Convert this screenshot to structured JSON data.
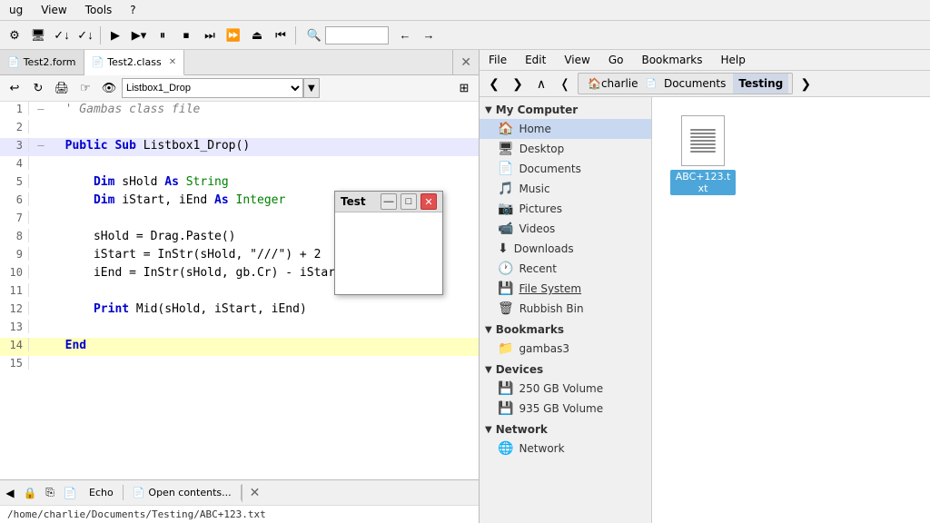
{
  "app_menu": {
    "items": [
      "ug",
      "View",
      "Tools",
      "?"
    ]
  },
  "toolbar": {
    "buttons": [
      "gear",
      "screen",
      "check-down",
      "check-down-2",
      "play",
      "play-drop",
      "pause",
      "stop",
      "step-over",
      "fast-forward",
      "eject",
      "step-into"
    ],
    "search_placeholder": ""
  },
  "nav": {
    "back": "‹",
    "forward": "›"
  },
  "editor": {
    "tabs": [
      {
        "label": "Test2.form",
        "icon": "📄",
        "active": false
      },
      {
        "label": "Test2.class",
        "icon": "📄",
        "active": true
      }
    ],
    "current_function": "Listbox1_Drop",
    "lines": [
      {
        "num": "1",
        "marker": "—",
        "content": "' Gambas class file",
        "type": "comment"
      },
      {
        "num": "2",
        "marker": "",
        "content": "",
        "type": "blank"
      },
      {
        "num": "3",
        "marker": "—",
        "content": "Public Sub Listbox1_Drop()",
        "type": "code"
      },
      {
        "num": "4",
        "marker": "",
        "content": "",
        "type": "blank"
      },
      {
        "num": "5",
        "marker": "",
        "content": "    Dim sHold As String",
        "type": "code"
      },
      {
        "num": "6",
        "marker": "",
        "content": "    Dim iStart, iEnd As Integer",
        "type": "code"
      },
      {
        "num": "7",
        "marker": "",
        "content": "",
        "type": "blank"
      },
      {
        "num": "8",
        "marker": "",
        "content": "    sHold = Drag.Paste()",
        "type": "code"
      },
      {
        "num": "9",
        "marker": "",
        "content": "    iStart = InStr(sHold, \"///\") + 2",
        "type": "code"
      },
      {
        "num": "10",
        "marker": "",
        "content": "    iEnd = InStr(sHold, gb.Cr) - iStart",
        "type": "code"
      },
      {
        "num": "11",
        "marker": "",
        "content": "",
        "type": "blank"
      },
      {
        "num": "12",
        "marker": "",
        "content": "    Print Mid(sHold, iStart, iEnd)",
        "type": "code"
      },
      {
        "num": "13",
        "marker": "",
        "content": "",
        "type": "blank"
      },
      {
        "num": "14",
        "marker": "",
        "content": "End",
        "type": "end"
      },
      {
        "num": "15",
        "marker": "",
        "content": "",
        "type": "blank"
      }
    ]
  },
  "status_bar": {
    "tabs": [
      {
        "label": "Echo",
        "icon": "≡"
      },
      {
        "label": "Open contents...",
        "icon": "📄"
      }
    ],
    "nav_back": "◀",
    "nav_fwd": "▶",
    "lock_icon": "🔒",
    "copy_icon": "⎘",
    "path": "/home/charlie/Documents/Testing/ABC+123.txt"
  },
  "file_manager": {
    "menu_items": [
      "File",
      "Edit",
      "View",
      "Go",
      "Bookmarks",
      "Help"
    ],
    "nav": {
      "back": "❮",
      "forward": "❯",
      "up": "∧",
      "left_arrow": "❬"
    },
    "breadcrumb": [
      {
        "label": "charlie",
        "icon": "🏠",
        "active": false
      },
      {
        "label": "Documents",
        "icon": "📄",
        "active": false
      },
      {
        "label": "Testing",
        "icon": "",
        "active": true
      }
    ],
    "tree": {
      "my_computer": {
        "label": "My Computer",
        "items": [
          {
            "label": "Home",
            "icon": "🏠",
            "active": true
          },
          {
            "label": "Desktop",
            "icon": "🖥"
          },
          {
            "label": "Documents",
            "icon": "📄"
          },
          {
            "label": "Music",
            "icon": "🎵"
          },
          {
            "label": "Pictures",
            "icon": "📷"
          },
          {
            "label": "Videos",
            "icon": "🎬"
          },
          {
            "label": "Downloads",
            "icon": "⬇"
          },
          {
            "label": "Recent",
            "icon": "🕐"
          },
          {
            "label": "File System",
            "icon": "💾"
          },
          {
            "label": "Rubbish Bin",
            "icon": "🗑"
          }
        ]
      },
      "bookmarks": {
        "label": "Bookmarks",
        "items": [
          {
            "label": "gambas3",
            "icon": "📁"
          }
        ]
      },
      "devices": {
        "label": "Devices",
        "items": [
          {
            "label": "250 GB Volume",
            "icon": "💾"
          },
          {
            "label": "935 GB Volume",
            "icon": "💾"
          }
        ]
      },
      "network": {
        "label": "Network",
        "items": [
          {
            "label": "Network",
            "icon": "🌐"
          }
        ]
      }
    },
    "files": [
      {
        "name": "ABC+123.txt",
        "selected": true
      }
    ]
  },
  "dialog": {
    "title": "Test",
    "minimize": "—",
    "maximize": "□",
    "close": "✕"
  }
}
